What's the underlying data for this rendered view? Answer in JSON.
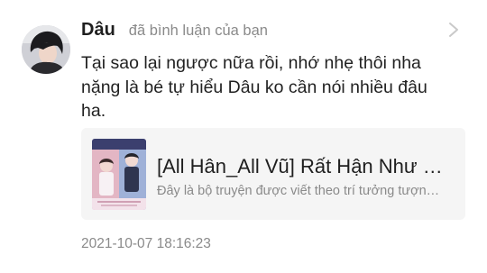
{
  "comment_item": {
    "avatar_icon": "user-avatar",
    "username": "Dâu",
    "action_text": "đã bình luận của bạn",
    "chevron_icon": "chevron-right-icon",
    "comment_text": "Tại sao lại ngược nữa rồi, nhớ nhẹ thôi nha\nnặng là bé tự hiểu Dâu ko cần nói nhiều đâu\nha.",
    "story_card": {
      "cover_icon": "book-cover-image",
      "title": "[All Hân_All Vũ] Rất Hận Như Rất Yêu",
      "description": "Đây là bộ truyện được viết theo trí tưởng tượng của tác giả"
    },
    "timestamp": "2021-10-07 18:16:23"
  },
  "colors": {
    "background": "#ffffff",
    "card_background": "#f5f5f5",
    "primary_text": "#222222",
    "secondary_text": "#8a8a8a"
  }
}
